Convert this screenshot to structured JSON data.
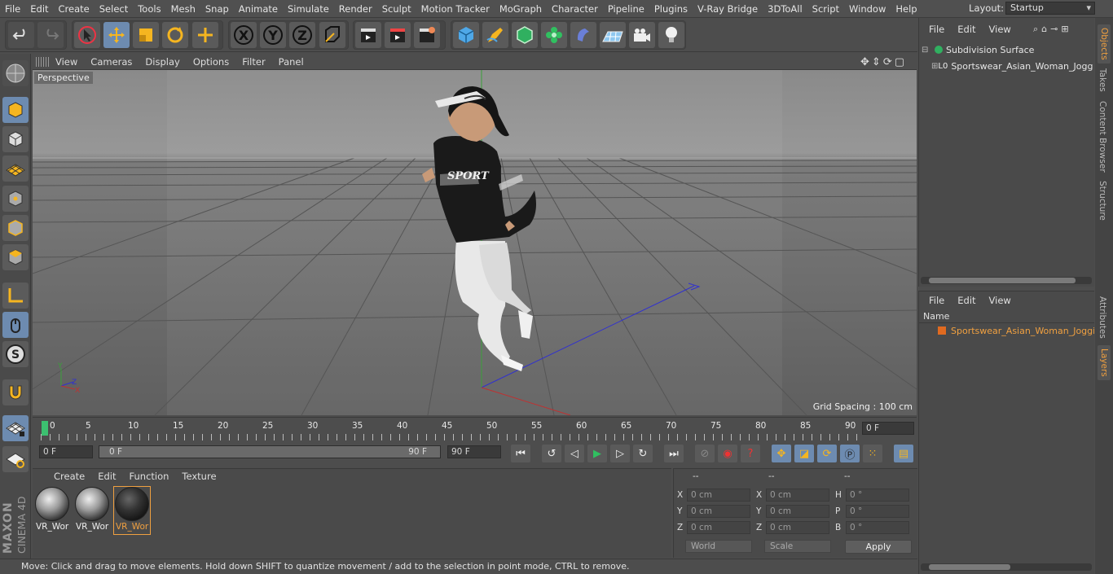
{
  "menubar": {
    "items": [
      "File",
      "Edit",
      "Create",
      "Select",
      "Tools",
      "Mesh",
      "Snap",
      "Animate",
      "Simulate",
      "Render",
      "Sculpt",
      "Motion Tracker",
      "MoGraph",
      "Character",
      "Pipeline",
      "Plugins",
      "V-Ray Bridge",
      "3DToAll",
      "Script",
      "Window",
      "Help"
    ],
    "layout_label": "Layout:",
    "layout_value": "Startup"
  },
  "toolbar": {
    "axis_x": "X",
    "axis_y": "Y",
    "axis_z": "Z"
  },
  "viewport": {
    "menu": [
      "View",
      "Cameras",
      "Display",
      "Options",
      "Filter",
      "Panel"
    ],
    "label": "Perspective",
    "grid_spacing": "Grid Spacing : 100 cm",
    "shirt_text": "SPORT"
  },
  "timeline": {
    "ticks": [
      "0",
      "5",
      "10",
      "15",
      "20",
      "25",
      "30",
      "35",
      "40",
      "45",
      "50",
      "55",
      "60",
      "65",
      "70",
      "75",
      "80",
      "85",
      "90"
    ],
    "current_frame": "0 F",
    "start_field": "0 F",
    "range_start": "0 F",
    "range_end": "90 F",
    "end_field": "90 F"
  },
  "material_manager": {
    "menu": [
      "Create",
      "Edit",
      "Function",
      "Texture"
    ],
    "materials": [
      "VR_Wor",
      "VR_Wor",
      "VR_Wor"
    ]
  },
  "attributes": {
    "headers": [
      "--",
      "--",
      "--"
    ],
    "rows": [
      {
        "a": "X",
        "av": "0 cm",
        "b": "X",
        "bv": "0 cm",
        "c": "H",
        "cv": "0 °"
      },
      {
        "a": "Y",
        "av": "0 cm",
        "b": "Y",
        "bv": "0 cm",
        "c": "P",
        "cv": "0 °"
      },
      {
        "a": "Z",
        "av": "0 cm",
        "b": "Z",
        "bv": "0 cm",
        "c": "B",
        "cv": "0 °"
      }
    ],
    "coord_system": "World",
    "mode": "Scale",
    "apply": "Apply"
  },
  "status": "Move: Click and drag to move elements. Hold down SHIFT to quantize movement / add to the selection in point mode, CTRL to remove.",
  "objects_panel": {
    "menu": [
      "File",
      "Edit",
      "View"
    ],
    "items": [
      "Subdivision Surface",
      "Sportswear_Asian_Woman_Jogg"
    ]
  },
  "layers_panel": {
    "menu": [
      "File",
      "Edit",
      "View"
    ],
    "column": "Name",
    "items": [
      "Sportswear_Asian_Woman_Joggir"
    ]
  },
  "side_tabs": [
    "Objects",
    "Takes",
    "Content Browser",
    "Structure",
    "Attributes",
    "Layers"
  ],
  "brand": {
    "maxon": "MAXON",
    "product": "CINEMA 4D"
  },
  "colors": {
    "accent": "#6d8bb0",
    "selected_text": "#f0a040",
    "play": "#30c060"
  }
}
